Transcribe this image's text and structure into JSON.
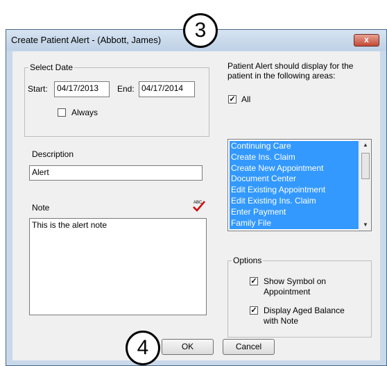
{
  "dialog": {
    "title": "Create Patient Alert - (Abbott, James)",
    "close_glyph": "x"
  },
  "select_date": {
    "legend": "Select Date",
    "start_label": "Start:",
    "start_value": "04/17/2013",
    "end_label": "End:",
    "end_value": "04/17/2014",
    "always_label": "Always",
    "always_checked": false
  },
  "description": {
    "label": "Description",
    "value": "Alert"
  },
  "note": {
    "label": "Note",
    "value": "This is the alert note",
    "spellcheck_icon": "spellcheck-icon"
  },
  "display_areas": {
    "heading": "Patient Alert should display for the patient in the following areas:",
    "all_label": "All",
    "all_checked": true,
    "items": [
      "Continuing Care",
      "Create Ins. Claim",
      "Create New Appointment",
      "Document Center",
      "Edit Existing Appointment",
      "Edit Existing Ins. Claim",
      "Enter Payment",
      "Family File"
    ]
  },
  "options": {
    "legend": "Options",
    "show_symbol_label": "Show Symbol on Appointment",
    "show_symbol_checked": true,
    "aged_balance_label": "Display Aged Balance with Note",
    "aged_balance_checked": true
  },
  "buttons": {
    "ok": "OK",
    "cancel": "Cancel"
  },
  "callouts": {
    "step3": "3",
    "step4": "4"
  }
}
